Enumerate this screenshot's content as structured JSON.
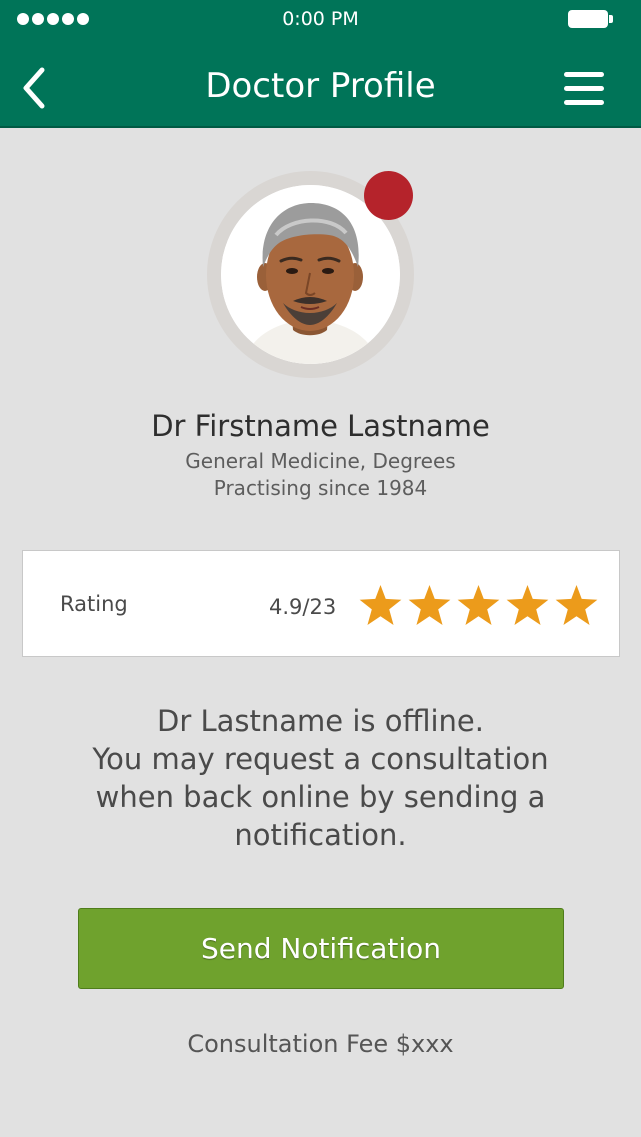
{
  "status_bar": {
    "time": "0:00 PM",
    "signal_dots": 5
  },
  "header": {
    "title": "Doctor Profile",
    "back_icon": "chevron-left-icon",
    "menu_icon": "hamburger-menu-icon"
  },
  "profile": {
    "name": "Dr Firstname Lastname",
    "specialty": "General Medicine, Degrees",
    "practising_since": "Practising since 1984",
    "online_status": "offline",
    "status_color": "#b5232b"
  },
  "rating": {
    "label": "Rating",
    "value": "4.9/23",
    "stars": 5,
    "star_color": "#ec9b1b"
  },
  "message": {
    "offline_text": "Dr Lastname is offline.\nYou may request a consultation when back online by sending a notification."
  },
  "actions": {
    "send_notification_label": "Send Notification"
  },
  "fee": {
    "text": "Consultation Fee $xxx"
  },
  "colors": {
    "header_bg": "#007458",
    "button_bg": "#6fa22d",
    "page_bg": "#e1e1e1"
  }
}
